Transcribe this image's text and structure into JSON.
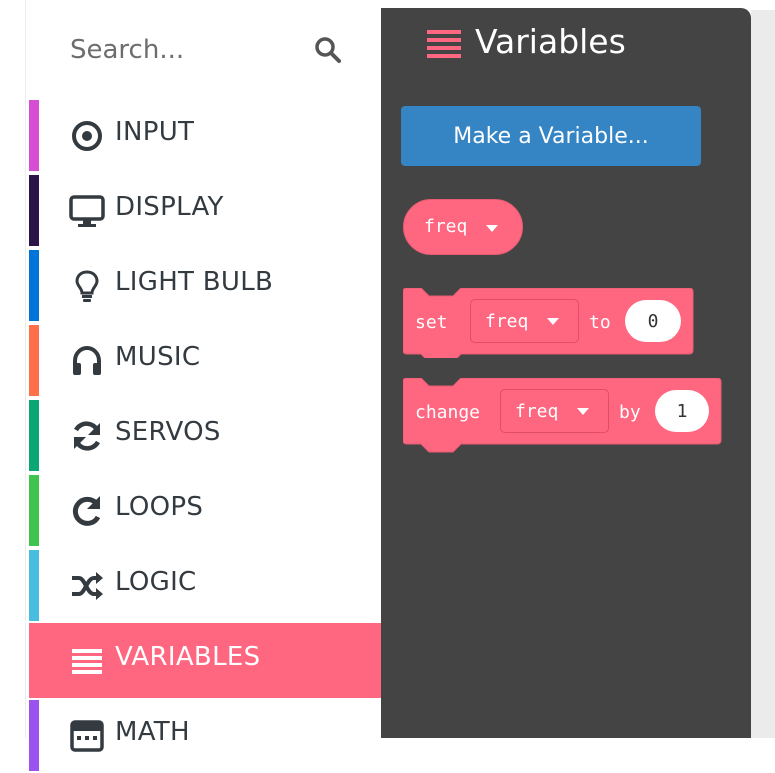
{
  "search": {
    "placeholder": "Search..."
  },
  "categories": [
    {
      "label": "INPUT",
      "color": "#d64fd3",
      "icon": "target-icon"
    },
    {
      "label": "DISPLAY",
      "color": "#2b1448",
      "icon": "monitor-icon"
    },
    {
      "label": "LIGHT BULB",
      "color": "#0074d9",
      "icon": "lightbulb-icon"
    },
    {
      "label": "MUSIC",
      "color": "#ff6f4a",
      "icon": "headphones-icon"
    },
    {
      "label": "SERVOS",
      "color": "#0aa775",
      "icon": "refresh-icon"
    },
    {
      "label": "LOOPS",
      "color": "#3ec44f",
      "icon": "redo-icon"
    },
    {
      "label": "LOGIC",
      "color": "#49bde0",
      "icon": "shuffle-icon"
    },
    {
      "label": "VARIABLES",
      "color": "#ff6680",
      "icon": "list-icon",
      "selected": true
    },
    {
      "label": "MATH",
      "color": "#9b52ee",
      "icon": "calculator-icon"
    }
  ],
  "flyout": {
    "title": "Variables",
    "make_variable_label": "Make a Variable...",
    "reporter_name": "freq",
    "set_block": {
      "keyword": "set",
      "variable": "freq",
      "connector": "to",
      "value": "0"
    },
    "change_block": {
      "keyword": "change",
      "variable": "freq",
      "connector": "by",
      "value": "1"
    }
  },
  "colors": {
    "variables": "#ff6680",
    "flyout_bg": "#444444",
    "button": "#3584c4"
  }
}
